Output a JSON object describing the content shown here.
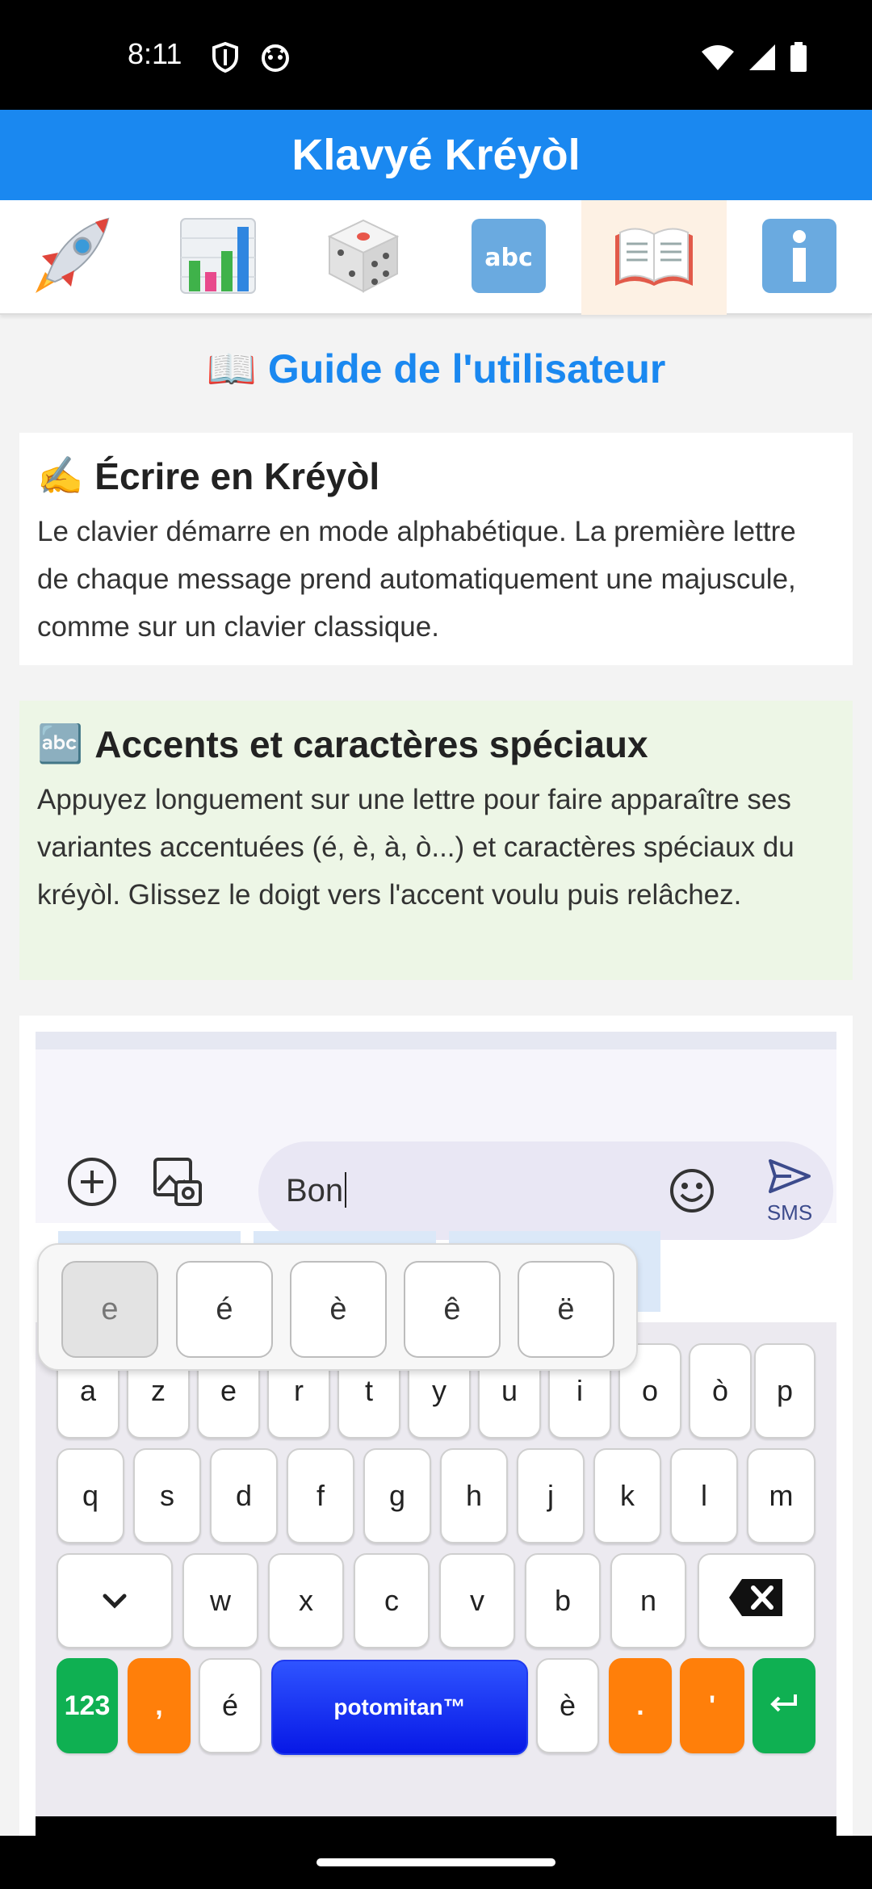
{
  "status_bar": {
    "time": "8:11",
    "left_icons": [
      "shield-icon",
      "cat-face-icon"
    ],
    "right_icons": [
      "wifi-icon",
      "signal-icon",
      "battery-icon"
    ]
  },
  "app_bar": {
    "title": "Klavyé Kréyòl",
    "color": "#1a88f0"
  },
  "tabs": [
    {
      "icon": "rocket-icon",
      "emoji": "🚀",
      "active": false
    },
    {
      "icon": "bar-chart-icon",
      "emoji": "📊",
      "active": false
    },
    {
      "icon": "dice-icon",
      "emoji": "🎲",
      "active": false
    },
    {
      "icon": "abc-icon",
      "emoji": "🔤",
      "active": false
    },
    {
      "icon": "open-book-icon",
      "emoji": "📖",
      "active": true
    },
    {
      "icon": "info-icon",
      "emoji": "ℹ️",
      "active": false
    }
  ],
  "guide": {
    "icon": "📖",
    "title": "Guide de l'utilisateur",
    "sections": [
      {
        "icon": "✍️",
        "title": "Écrire en Kréyòl",
        "body": "Le clavier démarre en mode alphabétique. La première lettre de chaque message prend automatiquement une majuscule, comme sur un clavier classique."
      },
      {
        "icon": "🔤",
        "title": "Accents et caractères spéciaux",
        "body": "Appuyez longuement sur une lettre pour faire apparaître ses variantes accentuées (é, è, à, ò...) et caractères spéciaux du kréyòl. Glissez le doigt vers l'accent voulu puis relâchez."
      }
    ]
  },
  "demo": {
    "message_text": "Bon",
    "send_label": "SMS",
    "icons": [
      "add-circle-icon",
      "gallery-icon",
      "emoji-icon",
      "send-icon"
    ],
    "accent_popup": [
      "e",
      "é",
      "è",
      "ê",
      "ë"
    ],
    "keyboard": {
      "row1": [
        "a",
        "z",
        "e",
        "r",
        "t",
        "y",
        "u",
        "i",
        "o",
        "ò",
        "p"
      ],
      "row2": [
        "q",
        "s",
        "d",
        "f",
        "g",
        "h",
        "j",
        "k",
        "l",
        "m"
      ],
      "row3": [
        "w",
        "x",
        "c",
        "v",
        "b",
        "n"
      ],
      "shift_icon": "chevron-down-icon",
      "backspace_icon": "backspace-icon",
      "num_label": "123",
      "comma_label": ",",
      "e_acute_label": "é",
      "space_label": "potomitan™",
      "e_grave_label": "è",
      "period_label": ".",
      "apostrophe_label": "'",
      "enter_icon": "enter-icon"
    }
  }
}
